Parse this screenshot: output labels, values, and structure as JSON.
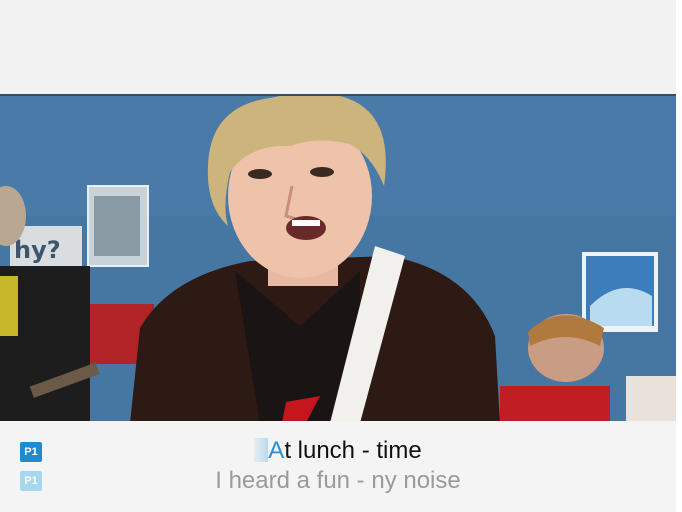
{
  "players": {
    "p1_label": "P1",
    "p2_label": "P1"
  },
  "lyrics": {
    "current_sung": "A",
    "current_rest": "t lunch - time",
    "next": "I heard a fun - ny noise"
  },
  "colors": {
    "sung_highlight": "#2a8fd6",
    "p1_badge": "#1e8bd0",
    "p2_badge": "#a7d6f0",
    "wall": "#4a7aa6"
  }
}
